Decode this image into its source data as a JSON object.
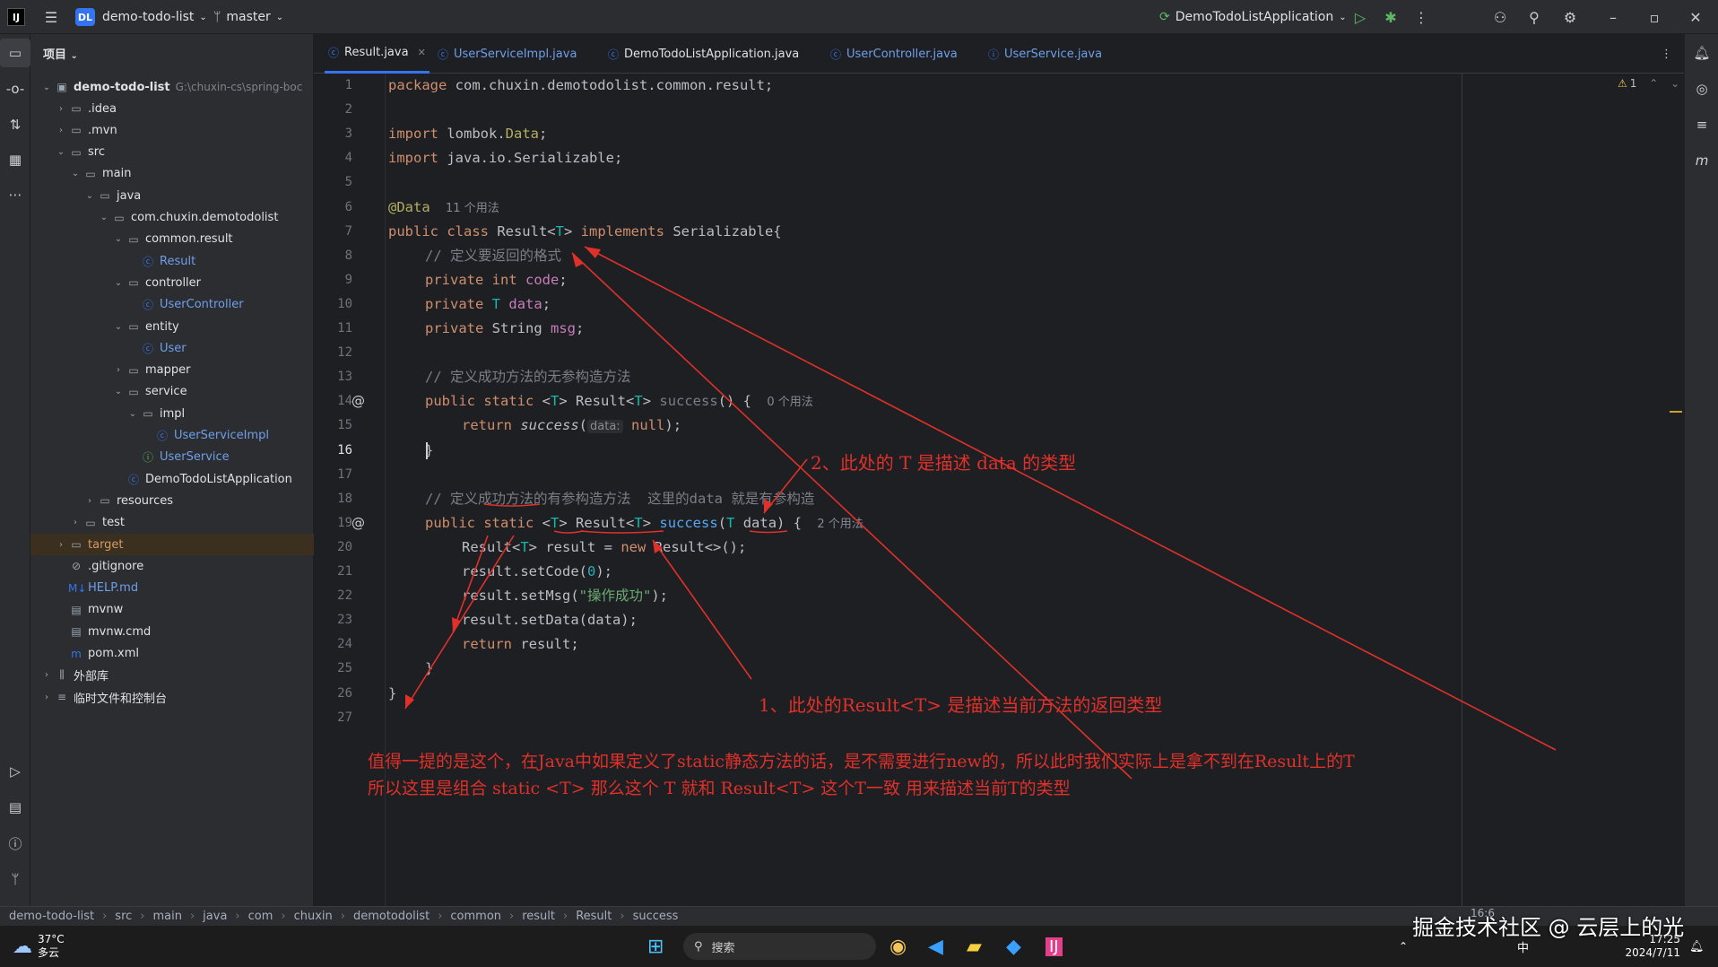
{
  "titlebar": {
    "logo": "IJ",
    "project_badge": "DL",
    "project_name": "demo-todo-list",
    "branch": "master",
    "run_config": "DemoTodoListApplication"
  },
  "project_panel": {
    "title": "项目",
    "root_name": "demo-todo-list",
    "root_path": "G:\\chuxin-cs\\spring-boc",
    "rows": [
      {
        "label": ".idea"
      },
      {
        "label": ".mvn"
      },
      {
        "label": "src"
      },
      {
        "label": "main"
      },
      {
        "label": "java"
      },
      {
        "label": "com.chuxin.demotodolist"
      },
      {
        "label": "common.result"
      },
      {
        "label": "Result"
      },
      {
        "label": "controller"
      },
      {
        "label": "UserController"
      },
      {
        "label": "entity"
      },
      {
        "label": "User"
      },
      {
        "label": "mapper"
      },
      {
        "label": "service"
      },
      {
        "label": "impl"
      },
      {
        "label": "UserServiceImpl"
      },
      {
        "label": "UserService"
      },
      {
        "label": "DemoTodoListApplication"
      },
      {
        "label": "resources"
      },
      {
        "label": "test"
      },
      {
        "label": "target"
      },
      {
        "label": ".gitignore"
      },
      {
        "label": "HELP.md"
      },
      {
        "label": "mvnw"
      },
      {
        "label": "mvnw.cmd"
      },
      {
        "label": "pom.xml"
      },
      {
        "label": "外部库"
      },
      {
        "label": "临时文件和控制台"
      }
    ]
  },
  "tabs": [
    {
      "label": "Result.java"
    },
    {
      "label": "UserServiceImpl.java"
    },
    {
      "label": "DemoTodoListApplication.java"
    },
    {
      "label": "UserController.java"
    },
    {
      "label": "UserService.java"
    }
  ],
  "editor": {
    "warning_count": "1",
    "line_numbers": [
      "1",
      "2",
      "3",
      "4",
      "5",
      "6",
      "7",
      "8",
      "9",
      "10",
      "11",
      "12",
      "13",
      "14",
      "15",
      "16",
      "17",
      "18",
      "19",
      "20",
      "21",
      "22",
      "23",
      "24",
      "25",
      "26",
      "27"
    ],
    "current_line": "16",
    "lines": {
      "l1_kw": "package",
      "l1_rest": " com.chuxin.demotodolist.common.result;",
      "l3_kw": "import",
      "l3_a": " lombok.",
      "l3_b": "Data",
      "l3_c": ";",
      "l4_kw": "import",
      "l4_rest": " java.io.Serializable;",
      "l6_an": "@Data",
      "l6_hint": "11 个用法",
      "l7_a": "public class",
      "l7_b": " Result<",
      "l7_t": "T",
      "l7_c": "> ",
      "l7_d": "implements",
      "l7_e": " Serializable{",
      "l8": "// 定义要返回的格式",
      "l9_kw": "private int",
      "l9_f": "code",
      "l9_e": ";",
      "l10_kw": "private",
      "l10_t": "T",
      "l10_f": "data",
      "l10_e": ";",
      "l11_kw": "private",
      "l11_a": " String ",
      "l11_f": "msg",
      "l11_e": ";",
      "l13": "// 定义成功方法的无参构造方法",
      "l14_kw": "public static",
      "l14_a": " <",
      "l14_t": "T",
      "l14_b": "> Result<",
      "l14_t2": "T",
      "l14_c": "> ",
      "l14_fn": "success",
      "l14_d": "() {",
      "l14_hint": "0 个用法",
      "l15_kw": "return",
      "l15_fn": "success",
      "l15_p": "(",
      "l15_param": "data:",
      "l15_kw2": "null",
      "l15_e": ");",
      "l16": "}",
      "l18": "// 定义成功方法的有参构造方法  这里的data 就是有参构造",
      "l19_kw": "public static",
      "l19_a": " <",
      "l19_t": "T",
      "l19_b": "> Result<",
      "l19_t2": "T",
      "l19_c": "> ",
      "l19_fn": "success",
      "l19_d": "(",
      "l19_t3": "T",
      "l19_e": " data) {",
      "l19_hint": "2 个用法",
      "l20_a": "Result<",
      "l20_t": "T",
      "l20_b": "> result = ",
      "l20_kw": "new",
      "l20_c": " Result<>();",
      "l21_a": "result.setCode(",
      "l21_n": "0",
      "l21_b": ");",
      "l22_a": "result.setMsg(",
      "l22_s": "\"操作成功\"",
      "l22_b": ");",
      "l23": "result.setData(data);",
      "l24_kw": "return",
      "l24_a": " result;",
      "l25": "}",
      "l26": "}"
    }
  },
  "annotations": {
    "note2": "2、此处的 T 是描述 data 的类型",
    "note1": "1、此处的Result<T> 是描述当前方法的返回类型",
    "note3_line1": "值得一提的是这个，在Java中如果定义了static静态方法的话，是不需要进行new的，所以此时我们实际上是拿不到在Result上的T",
    "note3_line2": "所以这里是组合 static <T> 那么这个 T 就和 Result<T> 这个T一致 用来描述当前T的类型"
  },
  "breadcrumb": [
    "demo-todo-list",
    "src",
    "main",
    "java",
    "com",
    "chuxin",
    "demotodolist",
    "common",
    "result",
    "Result",
    "success"
  ],
  "status": {
    "caret": "16:6"
  },
  "taskbar": {
    "weather_temp": "37°C",
    "weather_desc": "多云",
    "search_placeholder": "搜索",
    "time": "17:25",
    "date": "2024/7/11",
    "ime": "中",
    "watermark": "掘金技术社区 @ 云层上的光"
  },
  "colors": {
    "accent": "#3574f0",
    "annotation": "#e0302a",
    "background": "#1e1f22"
  }
}
